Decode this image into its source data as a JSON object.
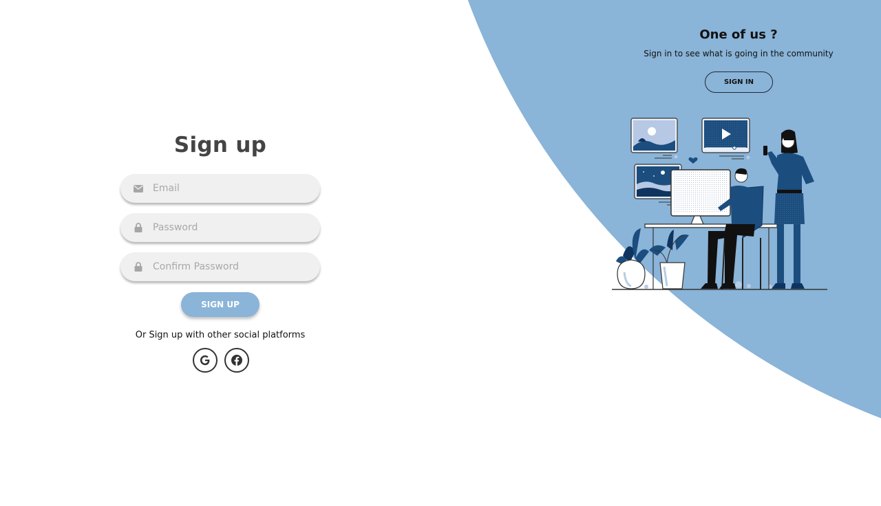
{
  "signup": {
    "title": "Sign up",
    "email_placeholder": "Email",
    "password_placeholder": "Password",
    "confirm_placeholder": "Confirm Password",
    "button_label": "SIGN UP",
    "social_text": "Or Sign up with other social platforms",
    "social": [
      {
        "name": "google",
        "icon": "google-icon"
      },
      {
        "name": "facebook",
        "icon": "facebook-icon"
      }
    ]
  },
  "panel": {
    "title": "One of us ?",
    "subtitle": "Sign in to see what is going in the community",
    "button_label": "SIGN IN",
    "illustration": "people-working-with-computer-illustration"
  },
  "colors": {
    "accent": "#8ab4d8",
    "dark_blue": "#1b4d7e",
    "navy": "#0f3460",
    "field_bg": "#f0f0f0",
    "title_text": "#444444"
  }
}
